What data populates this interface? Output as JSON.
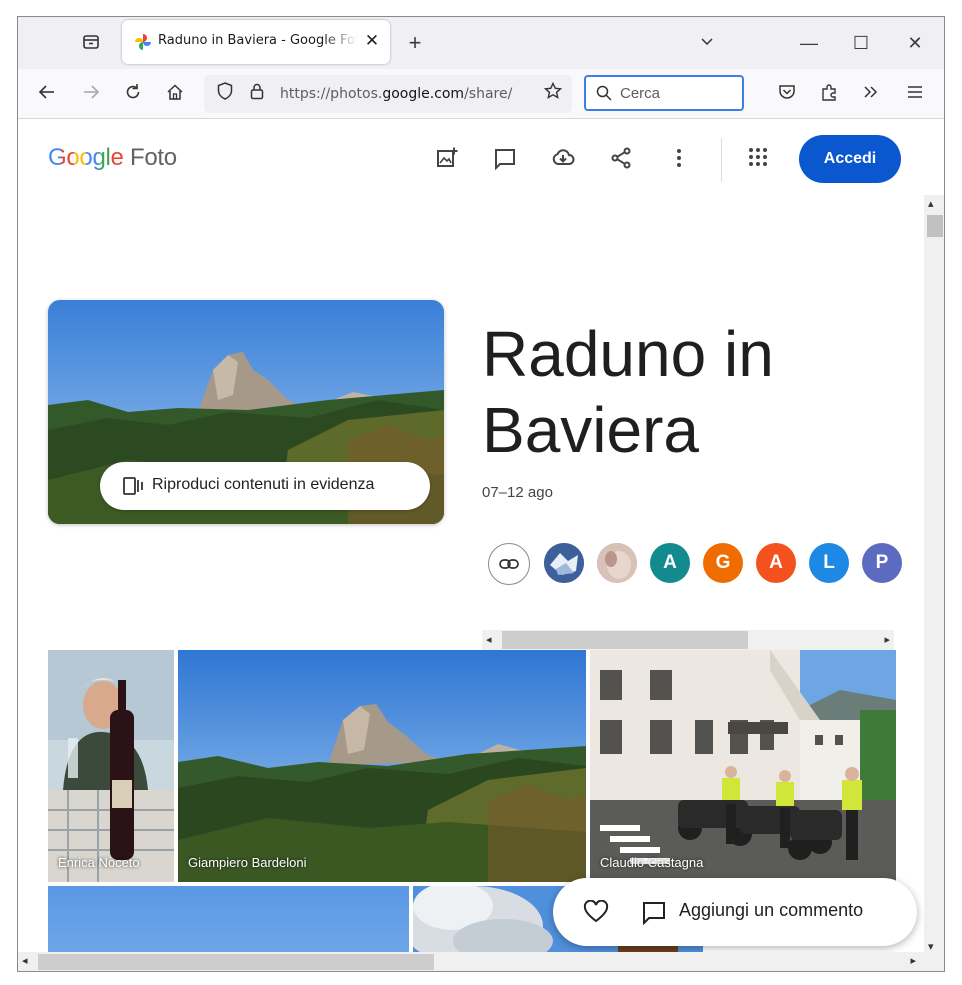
{
  "browser": {
    "tab": {
      "title": "Raduno in Baviera - Google Foto",
      "close": "✕"
    },
    "new_tab": "+",
    "list_tabs": "⌄",
    "window_controls": {
      "minimize": "—",
      "maximize": "☐",
      "close": "✕"
    },
    "url": {
      "prefix": "https://photos.",
      "domain": "google.com",
      "suffix": "/share/"
    },
    "search": {
      "placeholder": "Cerca"
    }
  },
  "app": {
    "logo": {
      "google": "Google",
      "foto": "Foto"
    },
    "signin_label": "Accedi",
    "album": {
      "title": "Raduno in Baviera",
      "dates": "07–12 ago",
      "play_label": "Riproduci contenuti in evidenza"
    },
    "contributors": [
      {
        "letter": "",
        "color": "#6f8fb5",
        "icon": "avatar-photo-1"
      },
      {
        "letter": "",
        "color": "#c9a69a",
        "icon": "avatar-photo-2"
      },
      {
        "letter": "A",
        "color": "#128a8e"
      },
      {
        "letter": "G",
        "color": "#ef6c00"
      },
      {
        "letter": "A",
        "color": "#f4511e"
      },
      {
        "letter": "L",
        "color": "#1e88e5"
      },
      {
        "letter": "P",
        "color": "#5c6bc0"
      }
    ],
    "photos": [
      {
        "owner": "Enrica Noceto"
      },
      {
        "owner": "Giampiero Bardeloni"
      },
      {
        "owner": "Claudio Castagna"
      }
    ],
    "comment_label": "Aggiungi un commento"
  }
}
